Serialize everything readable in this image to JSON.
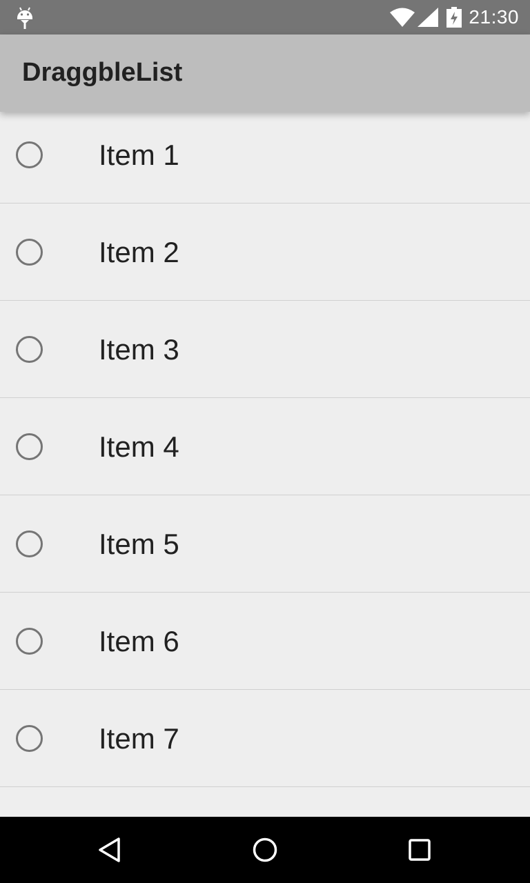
{
  "status_bar": {
    "time": "21:30",
    "icons": [
      "android-debug-icon",
      "wifi-icon",
      "signal-icon",
      "battery-charging-icon"
    ]
  },
  "app_bar": {
    "title": "DraggbleList"
  },
  "list": {
    "items": [
      {
        "label": "Item 1",
        "checked": false
      },
      {
        "label": "Item 2",
        "checked": false
      },
      {
        "label": "Item 3",
        "checked": false
      },
      {
        "label": "Item 4",
        "checked": false
      },
      {
        "label": "Item 5",
        "checked": false
      },
      {
        "label": "Item 6",
        "checked": false
      },
      {
        "label": "Item 7",
        "checked": false
      },
      {
        "label": "",
        "checked": false
      }
    ]
  },
  "nav_bar": {
    "icons": [
      "back-icon",
      "home-icon",
      "recents-icon"
    ]
  },
  "colors": {
    "status_bar": "#757575",
    "app_bar": "#bdbdbd",
    "background": "#eeeeee",
    "radio": "#757575",
    "text": "#212121",
    "nav_bar": "#000000"
  }
}
